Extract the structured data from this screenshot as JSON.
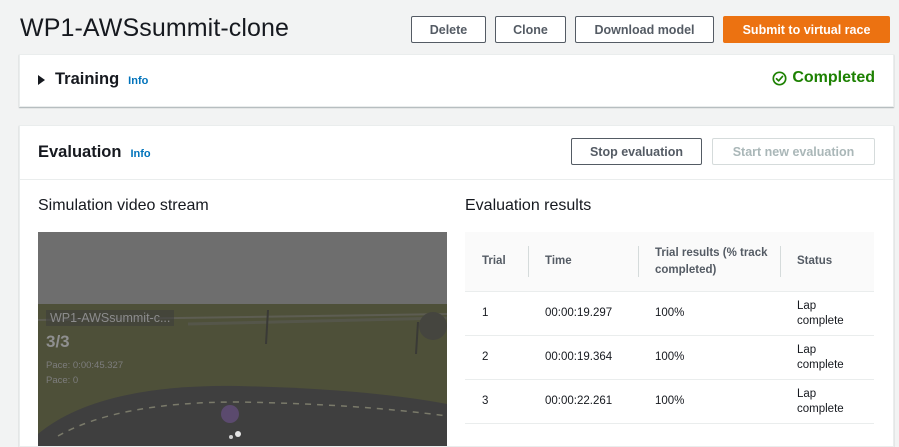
{
  "header": {
    "title": "WP1-AWSsummit-clone",
    "buttons": {
      "delete": "Delete",
      "clone": "Clone",
      "download": "Download model",
      "submit": "Submit to virtual race"
    }
  },
  "training": {
    "title": "Training",
    "info": "Info",
    "status": "Completed",
    "status_color": "#1d8102"
  },
  "evaluation": {
    "title": "Evaluation",
    "info": "Info",
    "stop_button": "Stop evaluation",
    "start_button": "Start new evaluation",
    "video_title": "Simulation video stream",
    "results_title": "Evaluation results",
    "video_overlay": {
      "model_name": "WP1-AWSsummit-c...",
      "lap": "3/3",
      "line1": "Pace: 0:00:45.327",
      "line2": "Pace: 0"
    },
    "table": {
      "columns": [
        "Trial",
        "Time",
        "Trial results (% track completed)",
        "Status"
      ],
      "rows": [
        {
          "trial": "1",
          "time": "00:00:19.297",
          "result": "100%",
          "status": "Lap complete"
        },
        {
          "trial": "2",
          "time": "00:00:19.364",
          "result": "100%",
          "status": "Lap complete"
        },
        {
          "trial": "3",
          "time": "00:00:22.261",
          "result": "100%",
          "status": "Lap complete"
        }
      ]
    }
  },
  "colors": {
    "primary": "#ec7211",
    "link": "#0073bb",
    "success": "#1d8102"
  }
}
